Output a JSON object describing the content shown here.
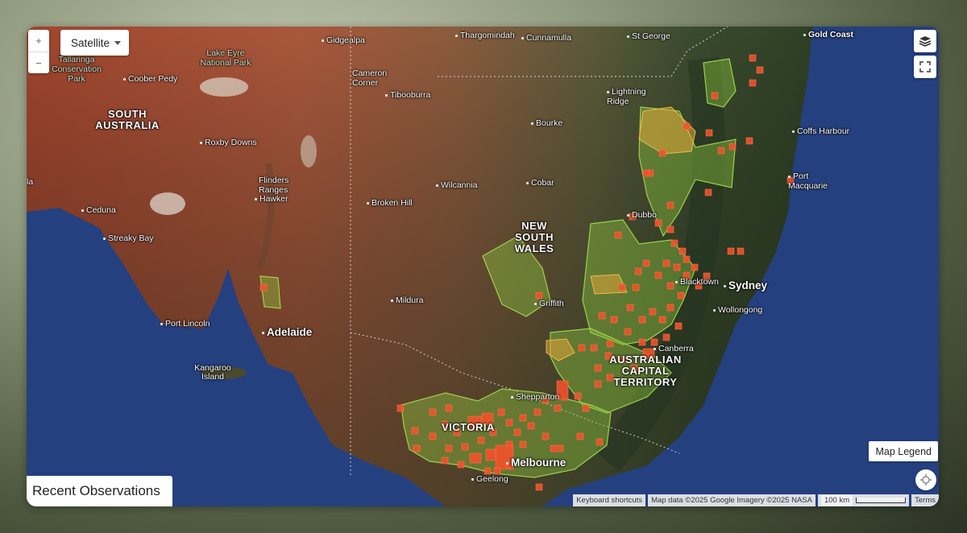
{
  "controls": {
    "zoom_in": "+",
    "zoom_out": "−",
    "map_type": "Satellite",
    "map_legend": "Map Legend",
    "recent_observations": "Recent Observations"
  },
  "labels": {
    "gidgealpa": "Gidgealpa",
    "thargomindah": "Thargomindah",
    "cunnamulla": "Cunnamulla",
    "st_george": "St George",
    "gold_coast": "Gold Coast",
    "lake_eyre": "Lake Eyre National Park",
    "tallaringa": "Tallaringa Conservation Park",
    "coober_pedy": "Coober Pedy",
    "cameron_corner": "Cameron Corner",
    "tibooburra": "Tibooburra",
    "lightning_ridge": "Lightning Ridge",
    "south_australia": "SOUTH AUSTRALIA",
    "roxby_downs": "Roxby Downs",
    "bourke": "Bourke",
    "coffs_harbour": "Coffs Harbour",
    "flinders_ranges": "Flinders Ranges",
    "hawker": "Hawker",
    "wilcannia": "Wilcannia",
    "cobar": "Cobar",
    "port_macquarie": "Port Macquarie",
    "broken_hill": "Broken Hill",
    "ceduna": "Ceduna",
    "dubbo": "Dubbo",
    "new_south_wales": "NEW SOUTH WALES",
    "streaky_bay": "Streaky Bay",
    "blacktown": "Blacktown",
    "sydney": "Sydney",
    "mildura": "Mildura",
    "griffith": "Griffith",
    "wollongong": "Wollongong",
    "port_lincoln": "Port Lincoln",
    "adelaide": "Adelaide",
    "canberra": "Canberra",
    "act": "AUSTRALIAN CAPITAL TERRITORY",
    "kangaroo_island": "Kangaroo Island",
    "shepparton": "Shepparton",
    "victoria": "VICTORIA",
    "melbourne": "Melbourne",
    "geelong": "Geelong",
    "la_fragment": "la"
  },
  "attribution": {
    "shortcuts": "Keyboard shortcuts",
    "map_data": "Map data ©2025 Google Imagery ©2025 NASA",
    "scale": "100 km",
    "terms": "Terms"
  },
  "colors": {
    "ocean": "#24407f",
    "desert": "#a8553a",
    "forest": "#34472c",
    "observation": "#f2512b",
    "region_green": "#8cc63f",
    "region_orange": "#e0a43a"
  }
}
